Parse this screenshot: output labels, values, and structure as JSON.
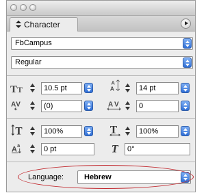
{
  "panel": {
    "tab_label": "Character"
  },
  "font": {
    "family": "FbCampus",
    "style": "Regular"
  },
  "metrics": {
    "font_size": "10.5 pt",
    "leading": "14 pt",
    "kerning": "(0)",
    "tracking": "0",
    "vertical_scale": "100%",
    "horizontal_scale": "100%",
    "baseline_shift": "0 pt",
    "skew": "0°"
  },
  "language": {
    "label": "Language:",
    "value": "Hebrew"
  },
  "colors": {
    "accent_blue": "#2f6fd6",
    "highlight_oval": "#c1272d"
  }
}
